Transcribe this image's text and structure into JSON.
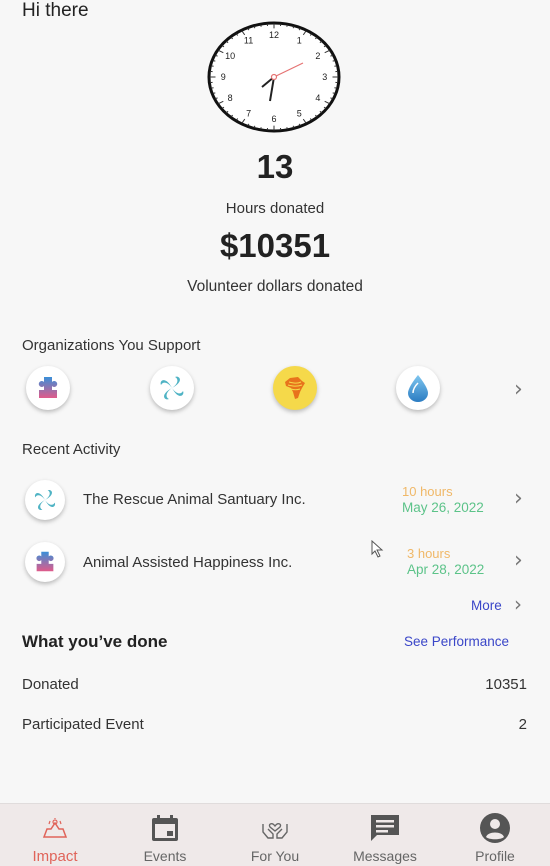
{
  "greeting": "Hi there",
  "clock": {
    "numbers": [
      "12",
      "1",
      "2",
      "3",
      "4",
      "5",
      "6",
      "7",
      "8",
      "9",
      "10",
      "11"
    ],
    "hand_color": "#e57373"
  },
  "stats": {
    "hours_value": "13",
    "hours_label": "Hours donated",
    "dollars_value": "$10351",
    "dollars_label": "Volunteer dollars donated"
  },
  "organizations": {
    "title": "Organizations You Support",
    "icons": [
      "puzzle-icon",
      "swirl-icon",
      "africa-map-icon",
      "water-drop-icon"
    ]
  },
  "recent_activity": {
    "title": "Recent Activity",
    "items": [
      {
        "icon": "swirl-icon",
        "name": "The Rescue Animal Santuary Inc.",
        "hours": "10 hours",
        "date": "May 26, 2022"
      },
      {
        "icon": "puzzle-icon",
        "name": "Animal Assisted Happiness Inc.",
        "hours": "3 hours",
        "date": "Apr 28, 2022"
      }
    ],
    "more_label": "More"
  },
  "what_done": {
    "title": "What you’ve done",
    "see_performance": "See Performance",
    "rows": [
      {
        "label": "Donated",
        "value": "10351"
      },
      {
        "label": "Participated Event",
        "value": "2"
      }
    ]
  },
  "nav": {
    "items": [
      {
        "label": "Impact",
        "icon": "impact-icon",
        "active": true
      },
      {
        "label": "Events",
        "icon": "calendar-icon",
        "active": false
      },
      {
        "label": "For You",
        "icon": "heart-hands-icon",
        "active": false
      },
      {
        "label": "Messages",
        "icon": "message-icon",
        "active": false
      },
      {
        "label": "Profile",
        "icon": "profile-icon",
        "active": false
      }
    ]
  },
  "colors": {
    "accent_blue": "#3a46c8",
    "hours_orange": "#f0b868",
    "date_green": "#5cc389",
    "active_nav": "#e0645a"
  }
}
